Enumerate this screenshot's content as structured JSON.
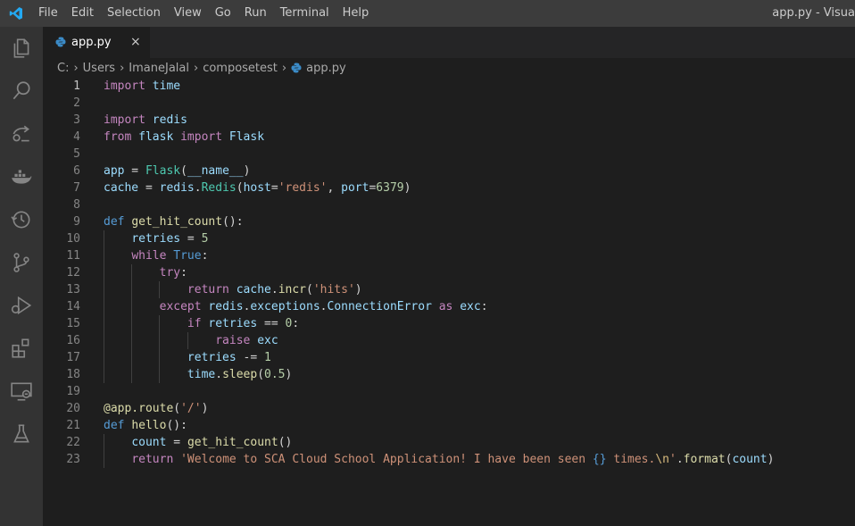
{
  "window": {
    "title": "app.py - Visua"
  },
  "menu": [
    "File",
    "Edit",
    "Selection",
    "View",
    "Go",
    "Run",
    "Terminal",
    "Help"
  ],
  "activity_bar": [
    "explorer-icon",
    "search-icon",
    "remote-explorer-icon",
    "docker-icon",
    "timeline-icon",
    "source-control-icon",
    "run-debug-icon",
    "extensions-icon",
    "remote-monitor-icon",
    "testing-icon"
  ],
  "tab": {
    "label": "app.py",
    "close": "×"
  },
  "breadcrumb": [
    "C:",
    "Users",
    "ImaneJalal",
    "composetest",
    "app.py"
  ],
  "active_line": 1,
  "colors": {
    "titlebar": "#3c3c3c",
    "activity": "#333333",
    "editor": "#1e1e1e",
    "accent": "#007acc"
  },
  "code": [
    {
      "n": "1",
      "text": "import time"
    },
    {
      "n": "2",
      "text": ""
    },
    {
      "n": "3",
      "text": "import redis"
    },
    {
      "n": "4",
      "text": "from flask import Flask"
    },
    {
      "n": "5",
      "text": ""
    },
    {
      "n": "6",
      "text": "app = Flask(__name__)"
    },
    {
      "n": "7",
      "text": "cache = redis.Redis(host='redis', port=6379)"
    },
    {
      "n": "8",
      "text": ""
    },
    {
      "n": "9",
      "text": "def get_hit_count():"
    },
    {
      "n": "10",
      "text": "    retries = 5"
    },
    {
      "n": "11",
      "text": "    while True:"
    },
    {
      "n": "12",
      "text": "        try:"
    },
    {
      "n": "13",
      "text": "            return cache.incr('hits')"
    },
    {
      "n": "14",
      "text": "        except redis.exceptions.ConnectionError as exc:"
    },
    {
      "n": "15",
      "text": "            if retries == 0:"
    },
    {
      "n": "16",
      "text": "                raise exc"
    },
    {
      "n": "17",
      "text": "            retries -= 1"
    },
    {
      "n": "18",
      "text": "            time.sleep(0.5)"
    },
    {
      "n": "19",
      "text": ""
    },
    {
      "n": "20",
      "text": "@app.route('/')"
    },
    {
      "n": "21",
      "text": "def hello():"
    },
    {
      "n": "22",
      "text": "    count = get_hit_count()"
    },
    {
      "n": "23",
      "text": "    return 'Welcome to SCA Cloud School Application! I have been seen {} times.\\n'.format(count)"
    }
  ]
}
